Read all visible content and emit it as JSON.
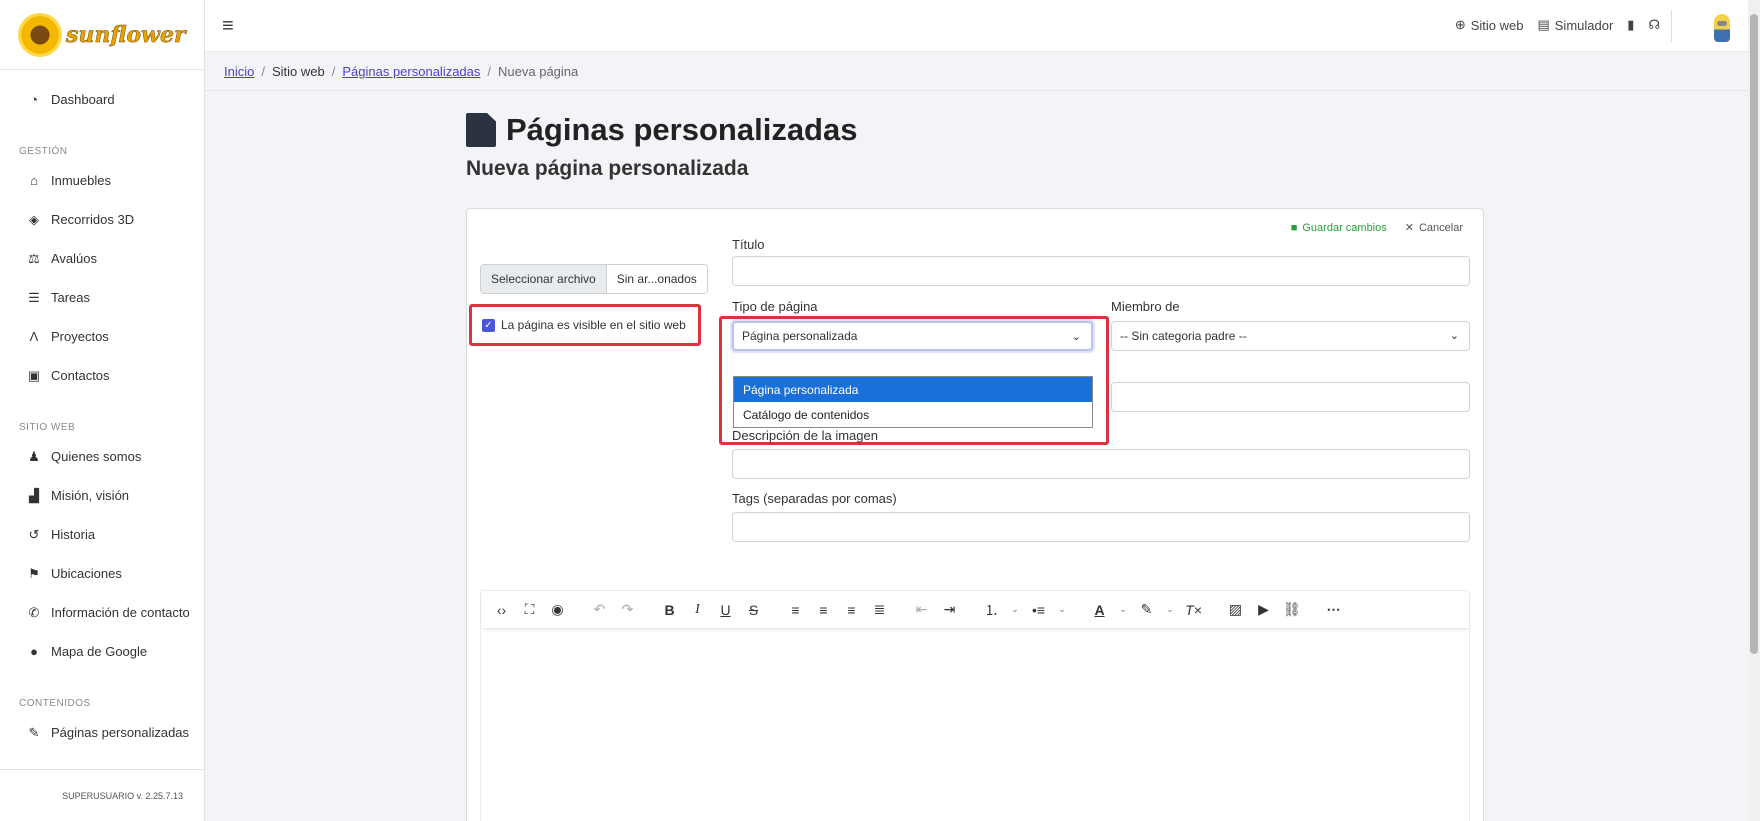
{
  "sidebar": {
    "logo_text": "sunflower",
    "dashboard": "Dashboard",
    "section_gestion": "GESTIÓN",
    "gestion_items": [
      "Inmuebles",
      "Recorridos 3D",
      "Avalúos",
      "Tareas",
      "Proyectos",
      "Contactos"
    ],
    "section_sitio": "SITIO WEB",
    "sitio_items": [
      "Quienes somos",
      "Misión, visión",
      "Historia",
      "Ubicaciones",
      "Información de contacto",
      "Mapa de Google"
    ],
    "section_contenidos": "CONTENIDOS",
    "contenidos_items": [
      "Páginas personalizadas"
    ],
    "footer": "SUPERUSUARIO v. 2.25.7.13"
  },
  "topbar": {
    "sitio_web": "Sitio web",
    "simulador": "Simulador"
  },
  "breadcrumb": {
    "inicio": "Inicio",
    "sitio_web": "Sitio web",
    "paginas": "Páginas personalizadas",
    "current": "Nueva página"
  },
  "page": {
    "title": "Páginas personalizadas",
    "subtitle": "Nueva página personalizada"
  },
  "card": {
    "save_label": "Guardar cambios",
    "cancel_label": "Cancelar",
    "file_button": "Seleccionar archivo",
    "file_name": "Sin ar...onados",
    "visible_checkbox_label": "La página es visible en el sitio web",
    "titulo_label": "Título",
    "tipo_label": "Tipo de página",
    "tipo_value": "Página personalizada",
    "tipo_options": [
      "Página personalizada",
      "Catálogo de contenidos"
    ],
    "miembro_label": "Miembro de",
    "miembro_value": "-- Sin categoria padre --",
    "descripcion_label": "Descripción de la imagen",
    "tags_label": "Tags (separadas por comas)"
  },
  "colors": {
    "highlight": "#d9333f",
    "selected_option": "#1a6fd8",
    "save_green": "#2a9d3b",
    "link": "#4a3fc9"
  }
}
